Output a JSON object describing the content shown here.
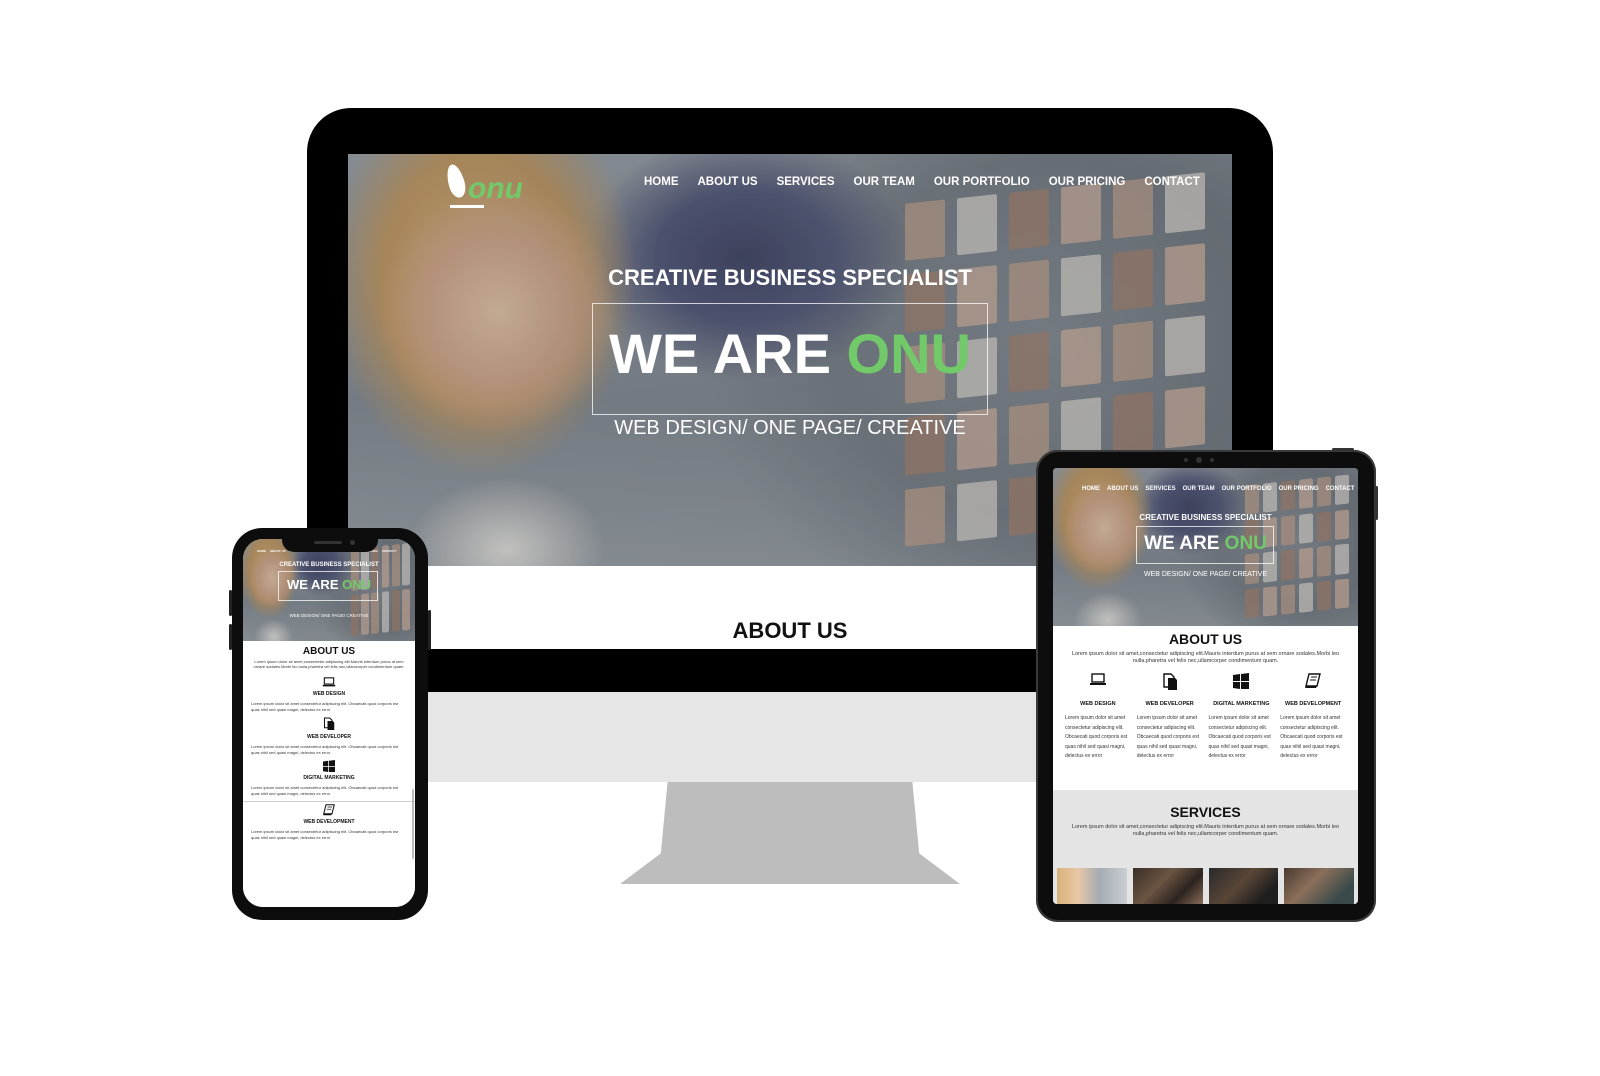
{
  "brand": {
    "logo_text": "onu",
    "accent_color": "#72c96a"
  },
  "nav": {
    "items": [
      {
        "label": "HOME"
      },
      {
        "label": "ABOUT US"
      },
      {
        "label": "SERVICES"
      },
      {
        "label": "OUR TEAM"
      },
      {
        "label": "OUR PORTFOLIO"
      },
      {
        "label": "OUR PRICING"
      },
      {
        "label": "CONTACT"
      }
    ]
  },
  "hero": {
    "kicker": "CREATIVE BUSINESS SPECIALIST",
    "title_prefix": "WE ARE",
    "title_brand": "ONU",
    "tagline": "WEB DESIGN/ ONE PAGE/ CREATIVE"
  },
  "about": {
    "title": "ABOUT US",
    "text": "Lorem ipsum dolor sit amet,consectetur adipiscing elit.Mauris interdum purus at sem ornare sodales.Morbi leo nulla,pharetra vel felis nec,ullamcorper condimentum quam."
  },
  "services": {
    "items": [
      {
        "icon": "laptop-icon",
        "name": "WEB DESIGN",
        "desc": "Lorem ipsum dolor sit amet consectetur adipiscing elit. Obcaecati quod corporis est quas nihil sed quasi magni, delectus ex error"
      },
      {
        "icon": "documents-icon",
        "name": "WEB DEVELOPER",
        "desc": "Lorem ipsum dolor sit amet consectetur adipiscing elit. Obcaecati quod corporis est quas nihil sed quasi magni, delectus ex error"
      },
      {
        "icon": "windows-icon",
        "name": "DIGITAL MARKETING",
        "desc": "Lorem ipsum dolor sit amet consectetur adipiscing elit. Obcaecati quod corporis est quas nihil sed quasi magni, delectus ex error"
      },
      {
        "icon": "book-icon",
        "name": "WEB DEVELOPMENT",
        "desc": "Lorem ipsum dolor sit amet consectetur adipiscing elit. Obcaecati quod corporis est quas nihil sed quasi magni, delectus ex error"
      }
    ]
  },
  "services_section": {
    "title": "SERVICES",
    "text": "Lorem ipsum dolor sit amet,consectetur adipiscing elit.Mauris interdum purus at sem ornare sodales.Morbi leo nulla,pharetra vel felis nec,ullamcorper condimentum quam."
  }
}
